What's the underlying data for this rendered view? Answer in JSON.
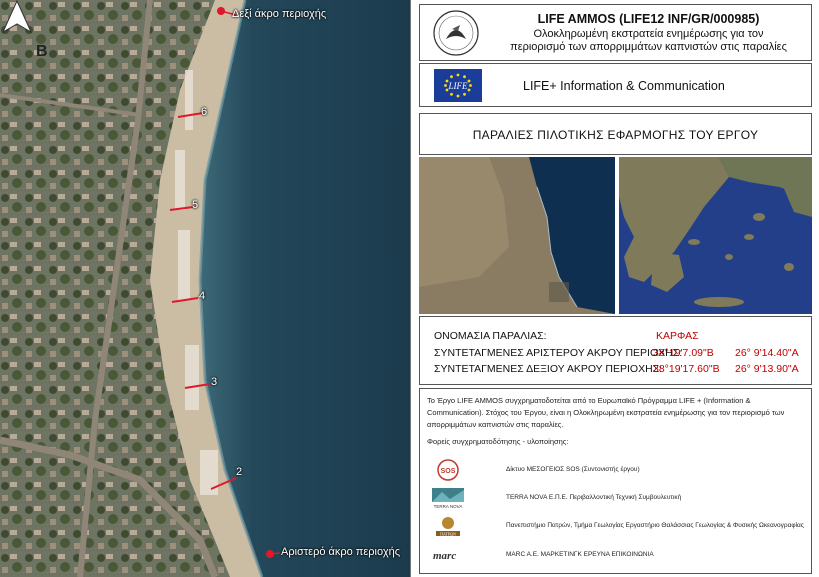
{
  "map": {
    "compass_letter": "B",
    "label_right_end": "Δεξί άκρο περιοχής",
    "label_left_end": "Αριστερό άκρο περιοχής",
    "markers": [
      "6",
      "5",
      "4",
      "3",
      "2"
    ]
  },
  "header": {
    "title": "LIFE AMMOS (LIFE12 INF/GR/000985)",
    "subtitle_line1": "Ολοκληρωμένη εκστρατεία ενημέρωσης για τον",
    "subtitle_line2": "περιορισμό των απορριμμάτων καπνιστών στις παραλίες"
  },
  "program": {
    "flag_text": "LIFE",
    "label": "LIFE+ Information & Communication"
  },
  "section_title": "ΠΑΡΑΛΙΕΣ ΠΙΛΟΤΙΚΗΣ ΕΦΑΡΜΟΓΗΣ ΤΟΥ ΕΡΓΟΥ",
  "beach": {
    "name_label": "ΟΝΟΜΑΣΙΑ ΠΑΡΑΛΙΑΣ:",
    "name_value": "ΚΑΡΦΑΣ",
    "left_label": "ΣΥΝΤΕΤΑΓΜΕΝΕΣ ΑΡΙΣΤΕΡΟΥ ΑΚΡΟΥ ΠΕΡΙΟΧΗΣ:",
    "left_lat": "38°19'7.09\"Β",
    "left_lon": "26° 9'14.40\"Α",
    "right_label": "ΣΥΝΤΕΤΑΓΜΕΝΕΣ ΔΕΞΙΟΥ ΑΚΡΟΥ ΠΕΡΙΟΧΗΣ:",
    "right_lat": "38°19'17.60\"Β",
    "right_lon": "26° 9'13.90\"Α"
  },
  "body": {
    "paragraph": "Το Έργο LIFE AMMOS συγχρηματοδοτείται από το Ευρωπαϊκό Πρόγραμμα LIFE + (Information & Communication). Στόχος του Έργου, είναι η Ολοκληρωμένη εκστρατεία ενημέρωσης για τον περιορισμό των απορριμμάτων καπνιστών στις παραλίες.",
    "partners_title": "Φορείς συγχρηματοδότησης - υλοποίησης:",
    "partners": [
      {
        "logo": "SOS",
        "text": "Δίκτυο ΜΕΣΟΓΕΙΟΣ SOS (Συντονιστής έργου)"
      },
      {
        "logo": "TERRA NOVA",
        "text": "TERRA NOVA Ε.Π.Ε. Περιβαλλοντική Τεχνική Συμβουλευτική"
      },
      {
        "logo": "ΠΑΤΡΩΝ",
        "text": "Πανεπιστήμιο Πατρών, Τμήμα Γεωλογίας Εργαστήριο Θαλάσσιας Γεωλογίας & Φυσικής Ωκεανογραφίας"
      },
      {
        "logo": "marc",
        "text": "MARC A.E. ΜΑΡΚΕΤΙΝΓΚ ΕΡΕΥΝΑ ΕΠΙΚΟΙΝΩΝΙΑ"
      }
    ]
  },
  "colors": {
    "sea": "#1f3f52",
    "sand": "#c9b9a0",
    "land": "#6d7362",
    "red_text": "#c00000",
    "eu_blue": "#1b3d9a"
  }
}
